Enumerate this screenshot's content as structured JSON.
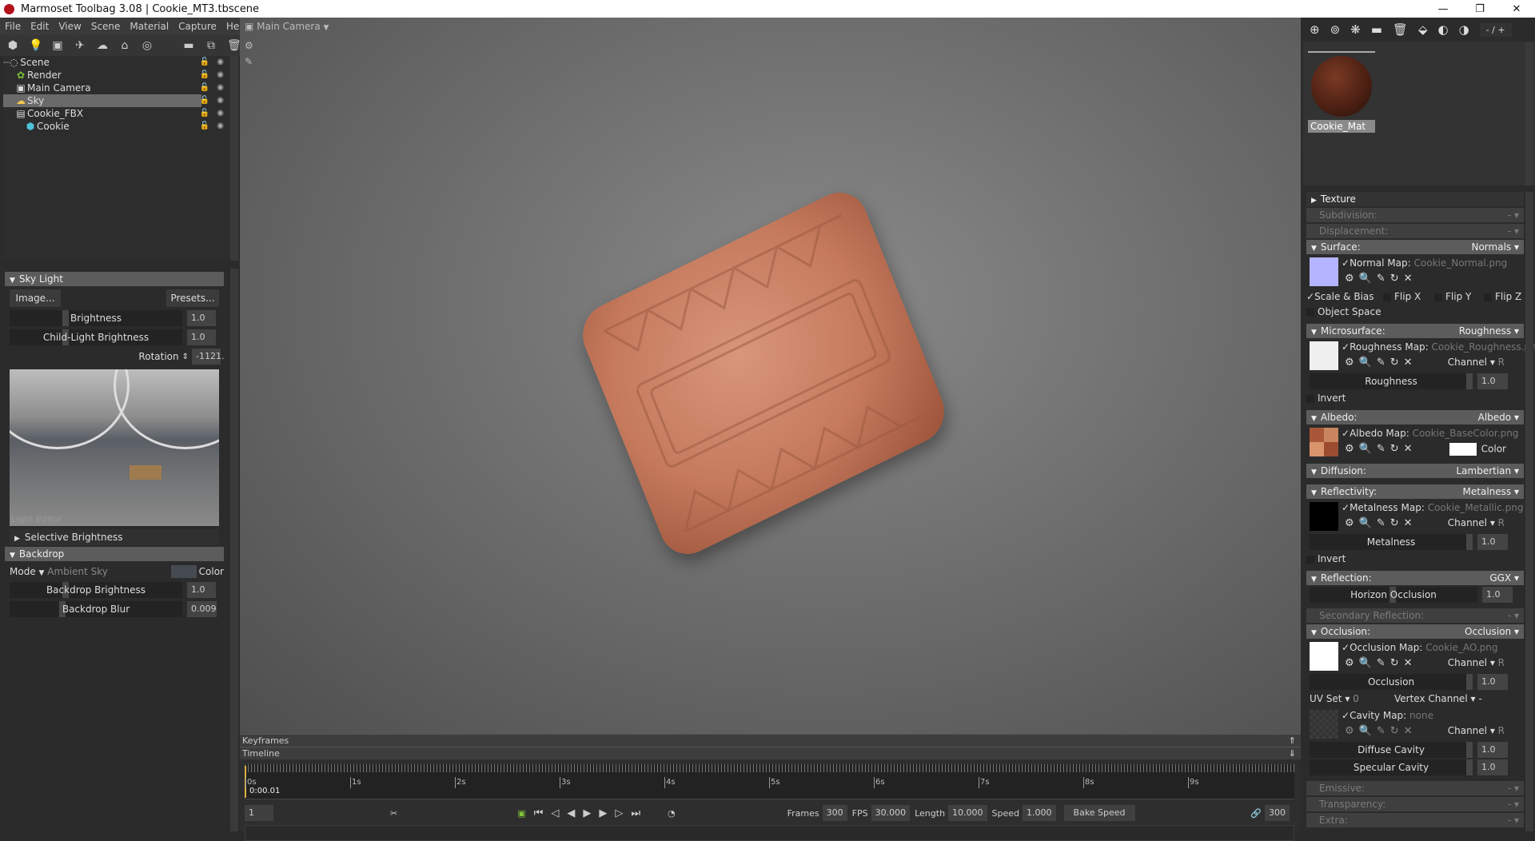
{
  "window": {
    "title": "Marmoset Toolbag 3.08  |  Cookie_MT3.tbscene",
    "minimize": "—",
    "maximize": "❐",
    "close": "✕"
  },
  "menu": [
    "File",
    "Edit",
    "View",
    "Scene",
    "Material",
    "Capture",
    "Help"
  ],
  "outliner": {
    "items": [
      {
        "label": "Scene",
        "icon": "scene-icon"
      },
      {
        "label": "Render",
        "icon": "render-gear-icon"
      },
      {
        "label": "Main Camera",
        "icon": "camera-icon"
      },
      {
        "label": "Sky",
        "icon": "sky-icon",
        "selected": true
      },
      {
        "label": "Cookie_FBX",
        "icon": "fbx-file-icon"
      },
      {
        "label": "Cookie",
        "icon": "mesh-cube-icon"
      }
    ]
  },
  "skylight": {
    "header": "Sky Light",
    "image_btn": "Image...",
    "presets_btn": "Presets...",
    "brightness_label": "Brightness",
    "brightness": "1.0",
    "child_label": "Child-Light Brightness",
    "child": "1.0",
    "rotation_label": "Rotation",
    "rotation": "-1121.",
    "light_editor": "Light Editor",
    "selective": "Selective Brightness"
  },
  "backdrop": {
    "header": "Backdrop",
    "mode_label": "Mode",
    "mode": "Ambient Sky",
    "color_label": "Color",
    "brightness_label": "Backdrop Brightness",
    "brightness": "1.0",
    "blur_label": "Backdrop Blur",
    "blur": "0.009"
  },
  "viewport": {
    "camera": "Main Camera"
  },
  "timeline": {
    "keyframes": "Keyframes",
    "timeline": "Timeline",
    "current_time": "0:00.01",
    "ticks": [
      "0s",
      "1s",
      "2s",
      "3s",
      "4s",
      "5s",
      "6s",
      "7s",
      "8s",
      "9s"
    ],
    "frame": "1",
    "frames_label": "Frames",
    "frames": "300",
    "fps_label": "FPS",
    "fps": "30.000",
    "length_label": "Length",
    "length": "10.000",
    "speed_label": "Speed",
    "speed": "1.000",
    "bake_speed": "Bake Speed",
    "end_frame": "300"
  },
  "material": {
    "name": "Cookie_Mat",
    "page": "- / +"
  },
  "props": {
    "texture": "Texture",
    "subdivision": "Subdivision:",
    "displacement": "Displacement:",
    "dash": "-",
    "surface": "Surface:",
    "surface_mode": "Normals",
    "normal_map": "Normal Map:",
    "normal_file": "Cookie_Normal.png",
    "scale_bias": "Scale & Bias",
    "flip_x": "Flip X",
    "flip_y": "Flip Y",
    "flip_z": "Flip Z",
    "object_space": "Object Space",
    "microsurface": "Microsurface:",
    "micro_mode": "Roughness",
    "rough_map": "Roughness Map:",
    "rough_file": "Cookie_Roughness.png",
    "channel": "Channel",
    "chan_r": "R",
    "roughness": "Roughness",
    "roughness_val": "1.0",
    "invert": "Invert",
    "albedo": "Albedo:",
    "albedo_mode": "Albedo",
    "albedo_map": "Albedo Map:",
    "albedo_file": "Cookie_BaseColor.png",
    "color": "Color",
    "diffusion": "Diffusion:",
    "diffusion_mode": "Lambertian",
    "reflectivity": "Reflectivity:",
    "refl_mode": "Metalness",
    "metal_map": "Metalness Map:",
    "metal_file": "Cookie_Metallic.png",
    "metalness": "Metalness",
    "metalness_val": "1.0",
    "reflection": "Reflection:",
    "reflection_mode": "GGX",
    "horizon": "Horizon Occlusion",
    "horizon_val": "1.0",
    "secondary": "Secondary Reflection:",
    "occlusion": "Occlusion:",
    "occlusion_mode": "Occlusion",
    "occ_map": "Occlusion Map:",
    "occ_file": "Cookie_AO.png",
    "occlusion_slider": "Occlusion",
    "occlusion_val": "1.0",
    "uv_set": "UV Set",
    "uv_val": "0",
    "vertex_channel": "Vertex Channel",
    "vertex_val": "-",
    "cavity_map": "Cavity Map:",
    "cavity_file": "none",
    "diffuse_cavity": "Diffuse Cavity",
    "diffuse_cavity_val": "1.0",
    "specular_cavity": "Specular Cavity",
    "specular_cavity_val": "1.0",
    "emissive": "Emissive:",
    "transparency": "Transparency:",
    "extra": "Extra:"
  },
  "colors": {
    "accent_green": "#7ec23a",
    "selection": "#6a6a6a",
    "normal_swatch": "#b4b4ff"
  }
}
